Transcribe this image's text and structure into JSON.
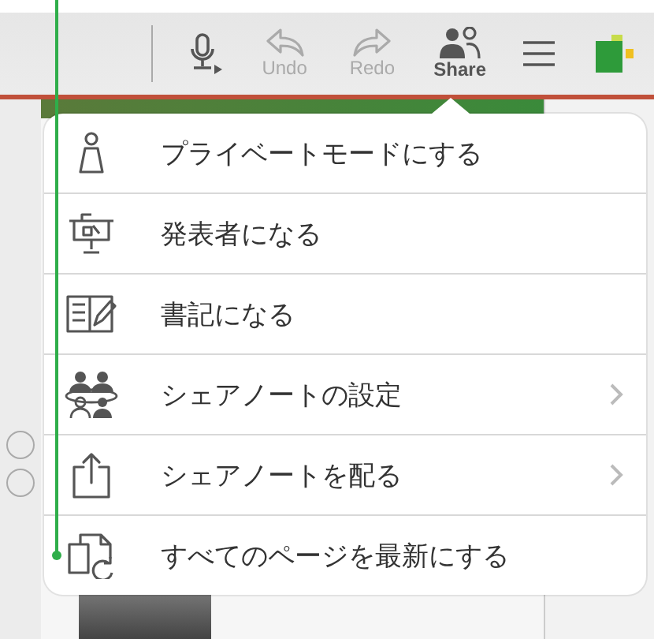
{
  "toolbar": {
    "items": [
      {
        "kind": "mic"
      },
      {
        "kind": "undo",
        "label": "Undo",
        "disabled": true
      },
      {
        "kind": "redo",
        "label": "Redo",
        "disabled": true
      },
      {
        "kind": "share",
        "label": "Share",
        "disabled": false
      },
      {
        "kind": "menu"
      },
      {
        "kind": "logo"
      }
    ]
  },
  "share_menu": {
    "items": [
      {
        "kind": "person",
        "label": "プライベートモードにする",
        "has_submenu": false
      },
      {
        "kind": "presenter",
        "label": "発表者になる",
        "has_submenu": false
      },
      {
        "kind": "notebook",
        "label": "書記になる",
        "has_submenu": false
      },
      {
        "kind": "group",
        "label": "シェアノートの設定",
        "has_submenu": true
      },
      {
        "kind": "export",
        "label": "シェアノートを配る",
        "has_submenu": true
      },
      {
        "kind": "refresh",
        "label": "すべてのページを最新にする",
        "has_submenu": false
      }
    ]
  }
}
